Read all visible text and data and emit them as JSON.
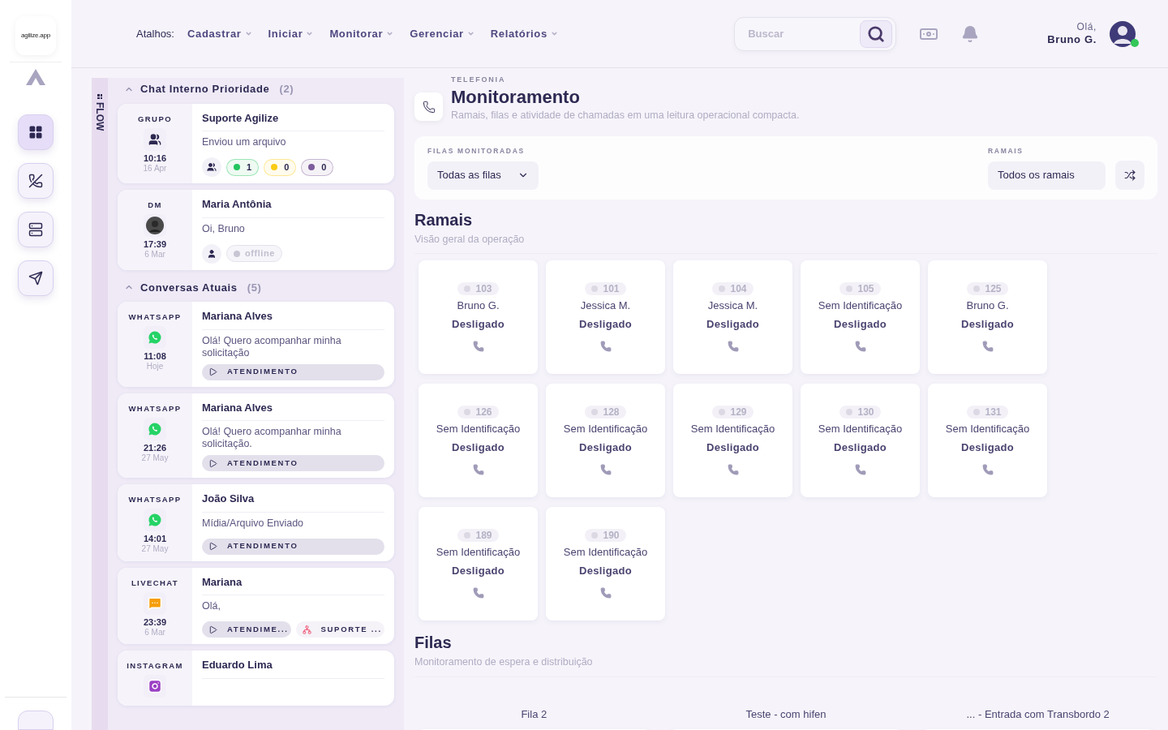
{
  "sidebar": {
    "logo": "agilize.app",
    "items": [
      {
        "kind": "grid",
        "selected": true
      },
      {
        "kind": "phone-off",
        "selected": false
      },
      {
        "kind": "server",
        "selected": false
      },
      {
        "kind": "send",
        "selected": false
      }
    ]
  },
  "topbar": {
    "shortcuts_label": "Atalhos:",
    "menus": [
      "Cadastrar",
      "Iniciar",
      "Monitorar",
      "Gerenciar",
      "Relatórios"
    ],
    "search": {
      "placeholder": "Buscar"
    },
    "greeting": "Olá,",
    "user": "Bruno G.",
    "online": true
  },
  "flow": {
    "label": "FLOW"
  },
  "chat_groups": [
    {
      "title": "Chat Interno Prioridade",
      "count": "(2)",
      "expanded": true,
      "items": [
        {
          "channel": "GRUPO",
          "kind": "group",
          "time": "10:16",
          "date": "16 Apr",
          "name": "Suporte Agilize",
          "preview": "Enviou um arquivo",
          "counters": [
            {
              "value": "1",
              "color": "#22c55e"
            },
            {
              "value": "0",
              "color": "#facc15"
            },
            {
              "value": "0",
              "color": "#7c5c9c"
            }
          ]
        },
        {
          "channel": "DM",
          "kind": "dm",
          "time": "17:39",
          "date": "6 Mar",
          "name": "Maria Antônia",
          "preview": "Oi, Bruno",
          "status": "offline"
        }
      ]
    },
    {
      "title": "Conversas Atuais",
      "count": "(5)",
      "expanded": true,
      "items": [
        {
          "channel": "WHATSAPP",
          "kind": "whatsapp",
          "time": "11:08",
          "date": "Hoje",
          "name": "Mariana Alves",
          "preview": "Olá! Quero acompanhar minha solicitação",
          "tags": [
            {
              "kind": "queue",
              "label": "ATENDIMENTO"
            }
          ]
        },
        {
          "channel": "WHATSAPP",
          "kind": "whatsapp",
          "time": "21:26",
          "date": "27 May",
          "name": "Mariana Alves",
          "preview": "Olá! Quero acompanhar minha solicitação.",
          "tags": [
            {
              "kind": "queue",
              "label": "ATENDIMENTO"
            }
          ]
        },
        {
          "channel": "WHATSAPP",
          "kind": "whatsapp",
          "time": "14:01",
          "date": "27 May",
          "name": "João Silva",
          "preview": "Mídia/Arquivo Enviado",
          "tags": [
            {
              "kind": "queue",
              "label": "ATENDIMENTO"
            }
          ]
        },
        {
          "channel": "LIVECHAT",
          "kind": "livechat",
          "time": "23:39",
          "date": "6 Mar",
          "name": "Mariana",
          "preview": "Olá,",
          "tags": [
            {
              "kind": "queue",
              "label": "ATENDIME..."
            },
            {
              "kind": "team",
              "label": "SUPORTE ..."
            }
          ]
        },
        {
          "channel": "INSTAGRAM",
          "kind": "instagram",
          "name": "Eduardo Lima"
        }
      ]
    }
  ],
  "header": {
    "eyebrow": "TELEFONIA",
    "title": "Monitoramento",
    "subtitle": "Ramais, filas e atividade de chamadas em uma leitura operacional compacta."
  },
  "filters": {
    "queues_label": "FILAS MONITORADAS",
    "queues_value": "Todas as filas",
    "ramais_label": "RAMAIS",
    "ramais_value": "Todos os ramais"
  },
  "ramais": {
    "title": "Ramais",
    "subtitle": "Visão geral da operação",
    "rows": [
      [
        {
          "number": "103",
          "name": "Bruno G.",
          "status": "Desligado"
        },
        {
          "number": "101",
          "name": "Jessica M.",
          "status": "Desligado"
        },
        {
          "number": "104",
          "name": "Jessica M.",
          "status": "Desligado"
        },
        {
          "number": "105",
          "name": "Sem Identificação",
          "status": "Desligado"
        },
        {
          "number": "125",
          "name": "Bruno G.",
          "status": "Desligado"
        }
      ],
      [
        {
          "number": "126",
          "name": "Sem Identificação",
          "status": "Desligado"
        },
        {
          "number": "128",
          "name": "Sem Identificação",
          "status": "Desligado"
        },
        {
          "number": "129",
          "name": "Sem Identificação",
          "status": "Desligado"
        },
        {
          "number": "130",
          "name": "Sem Identificação",
          "status": "Desligado"
        },
        {
          "number": "131",
          "name": "Sem Identificação",
          "status": "Desligado"
        }
      ],
      [
        {
          "number": "189",
          "name": "Sem Identificação",
          "status": "Desligado"
        },
        {
          "number": "190",
          "name": "Sem Identificação",
          "status": "Desligado"
        }
      ]
    ]
  },
  "filas": {
    "title": "Filas",
    "subtitle": "Monitoramento de espera e distribuição",
    "columns": [
      "Fila 2",
      "Teste - com hifen",
      "... - Entrada com Transbordo 2"
    ]
  }
}
